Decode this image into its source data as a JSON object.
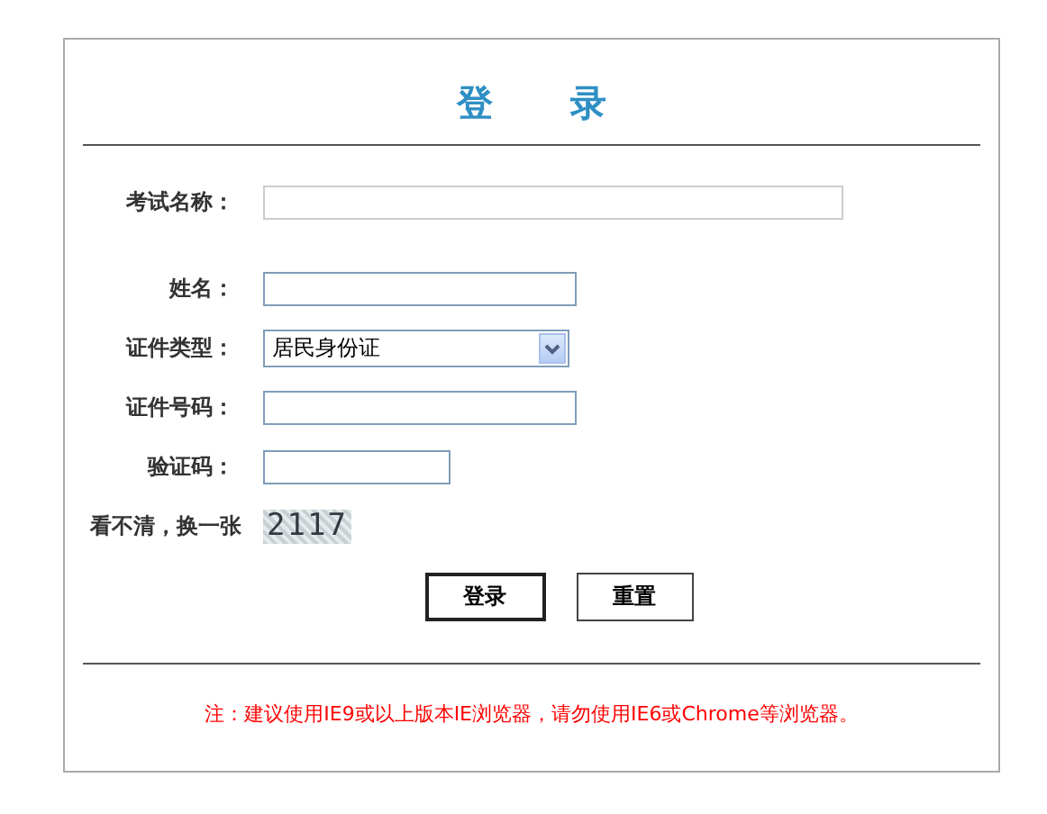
{
  "title": "登 录",
  "exam": {
    "label": "考试名称：",
    "kind": "input"
  },
  "fields": [
    {
      "label": "姓名：",
      "kind": "input"
    },
    {
      "label": "证件类型：",
      "kind": "select",
      "value": "居民身份证"
    },
    {
      "label": "证件号码：",
      "kind": "input"
    },
    {
      "label": "验证码：",
      "kind": "short-input"
    }
  ],
  "captcha": {
    "link": "看不清，换一张",
    "code": "2117"
  },
  "buttons": [
    {
      "label": "登录",
      "selected": true
    },
    {
      "label": "重置",
      "selected": false
    }
  ],
  "note": "注：建议使用IE9或以上版本IE浏览器，请勿使用IE6或Chrome等浏览器。"
}
